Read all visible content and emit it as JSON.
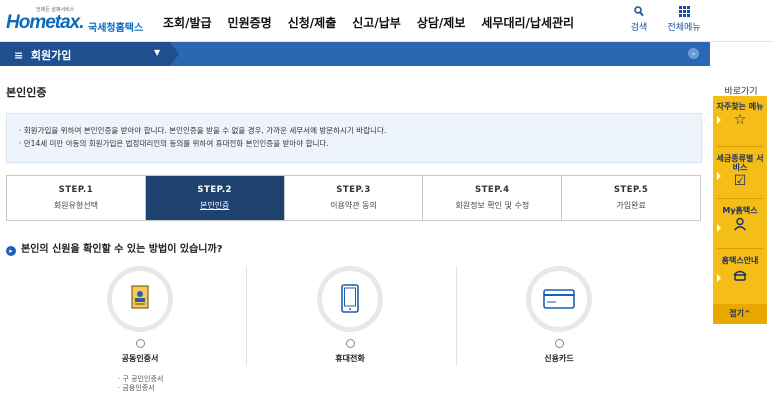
{
  "header": {
    "logo_tagline": "언제든 살펴서비스",
    "logo_text": "Hometax.",
    "logo_subtitle": "국세청홈택스",
    "menu": [
      "조회/발급",
      "민원증명",
      "신청/제출",
      "신고/납부",
      "상담/제보",
      "세무대리/납세관리"
    ],
    "search_label": "검색",
    "all_menu_label": "전체메뉴"
  },
  "navbar": {
    "menu_label": "회원가입"
  },
  "page": {
    "title": "본인인증",
    "notice": [
      "회원가입을 위하여 본인인증을 받아야 합니다. 본인인증을 받을 수 없을 경우, 가까운 세무서에 방문하시기 바랍니다.",
      "만14세 미만 아동의 회원가입은 법정대리인의 동의를 위하여 휴대전화 본인인증을 받아야 합니다."
    ]
  },
  "steps": [
    {
      "number": "STEP.1",
      "label": "회원유형선택",
      "active": false
    },
    {
      "number": "STEP.2",
      "label": "본인인증",
      "active": true
    },
    {
      "number": "STEP.3",
      "label": "이용약관 동의",
      "active": false
    },
    {
      "number": "STEP.4",
      "label": "회원정보 확인 및 수정",
      "active": false
    },
    {
      "number": "STEP.5",
      "label": "가입완료",
      "active": false
    }
  ],
  "question": "본인의 신원을 확인할 수 있는 방법이 있습니까?",
  "methods": [
    {
      "label": "공동인증서",
      "icon": "certificate-icon",
      "sub_items": [
        "구 공인인증서",
        "금융인증서"
      ]
    },
    {
      "label": "휴대전화",
      "icon": "mobile-phone-icon"
    },
    {
      "label": "신용카드",
      "icon": "credit-card-icon"
    }
  ],
  "quick_menu": {
    "title": "바로가기",
    "items": [
      {
        "label": "자주찾는 메뉴",
        "icon": "star-icon"
      },
      {
        "label": "세금종류별 서비스",
        "icon": "checkbox-icon"
      },
      {
        "label": "My홈택스",
        "icon": "user-icon"
      },
      {
        "label": "홈택스안내",
        "icon": "guide-icon"
      }
    ],
    "fold_label": "접기^"
  },
  "colors": {
    "brand_blue": "#0a6bbf",
    "nav_blue": "#2b68b3",
    "step_active": "#1e4270",
    "quick_yellow": "#f5bd17"
  }
}
